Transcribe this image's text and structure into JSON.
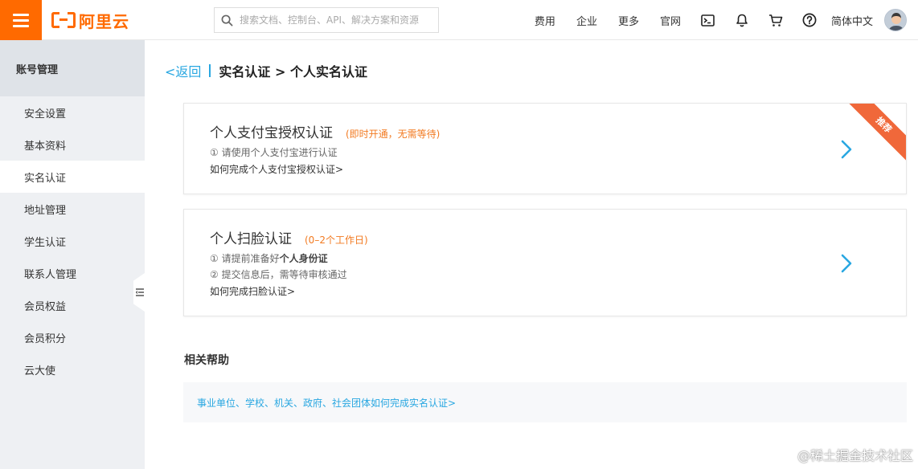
{
  "header": {
    "logo_text": "阿里云",
    "search_placeholder": "搜索文档、控制台、API、解决方案和资源",
    "nav": [
      "费用",
      "企业",
      "更多",
      "官网"
    ],
    "lang": "简体中文",
    "accent_color": "#ff6a00"
  },
  "sidebar": {
    "title": "账号管理",
    "items": [
      {
        "label": "安全设置"
      },
      {
        "label": "基本资料"
      },
      {
        "label": "实名认证",
        "active": true
      },
      {
        "label": "地址管理"
      },
      {
        "label": "学生认证"
      },
      {
        "label": "联系人管理"
      },
      {
        "label": "会员权益"
      },
      {
        "label": "会员积分"
      },
      {
        "label": "云大使"
      }
    ]
  },
  "breadcrumb": {
    "back": "<返回",
    "title": "实名认证 > 个人实名认证"
  },
  "cards": [
    {
      "title": "个人支付宝授权认证",
      "tag": "(即时开通，无需等待)",
      "lines": [
        "① 请使用个人支付宝进行认证"
      ],
      "link": "如何完成个人支付宝授权认证>",
      "ribbon": "推荐"
    },
    {
      "title": "个人扫脸认证",
      "tag": "(0–2个工作日)",
      "line1_prefix": "① 请提前准备好",
      "line1_bold": "个人身份证",
      "line2": "② 提交信息后，需等待审核通过",
      "link": "如何完成扫脸认证>"
    }
  ],
  "help": {
    "title": "相关帮助",
    "link": "事业单位、学校、机关、政府、社会团体如何完成实名认证>"
  },
  "watermark": "@稀土掘金技术社区"
}
